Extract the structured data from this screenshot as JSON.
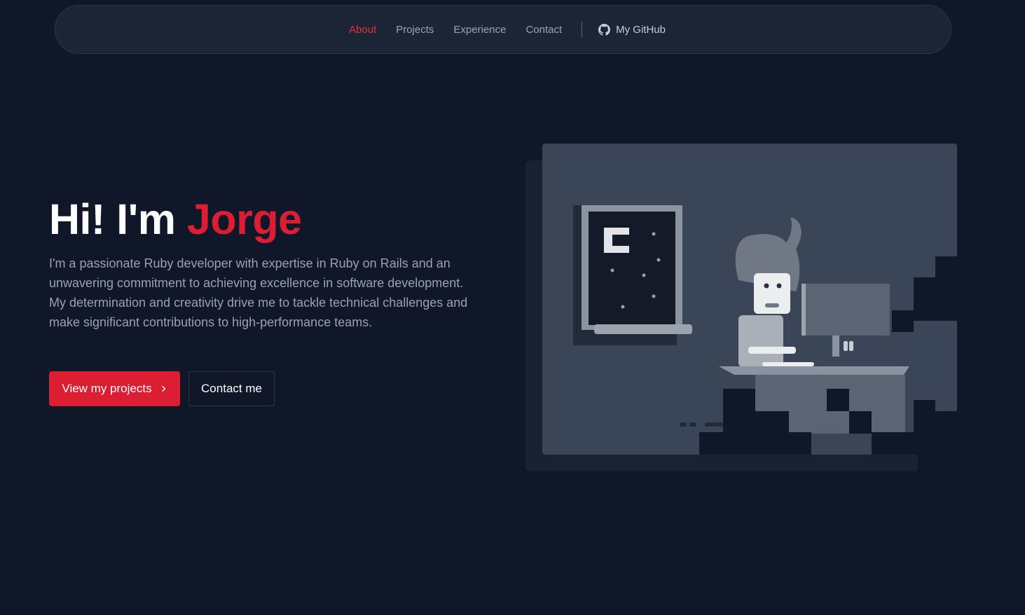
{
  "nav": {
    "links": [
      {
        "label": "About",
        "active": true
      },
      {
        "label": "Projects",
        "active": false
      },
      {
        "label": "Experience",
        "active": false
      },
      {
        "label": "Contact",
        "active": false
      }
    ],
    "github_label": "My GitHub",
    "github_icon": "github-icon"
  },
  "hero": {
    "greeting": "Hi! I'm",
    "name": "Jorge",
    "description": "I'm a passionate Ruby developer with expertise in Ruby on Rails and an unwavering commitment to achieving excellence in software development. My determination and creativity drive me to tackle technical challenges and make significant contributions to high-performance teams.",
    "primary_button": "View my projects",
    "primary_button_icon": "chevron-right-icon",
    "secondary_button": "Contact me"
  },
  "colors": {
    "background": "#0f1729",
    "accent": "#dc1e33",
    "nav_background": "#1c2535",
    "text_muted": "#9aa2b1"
  }
}
